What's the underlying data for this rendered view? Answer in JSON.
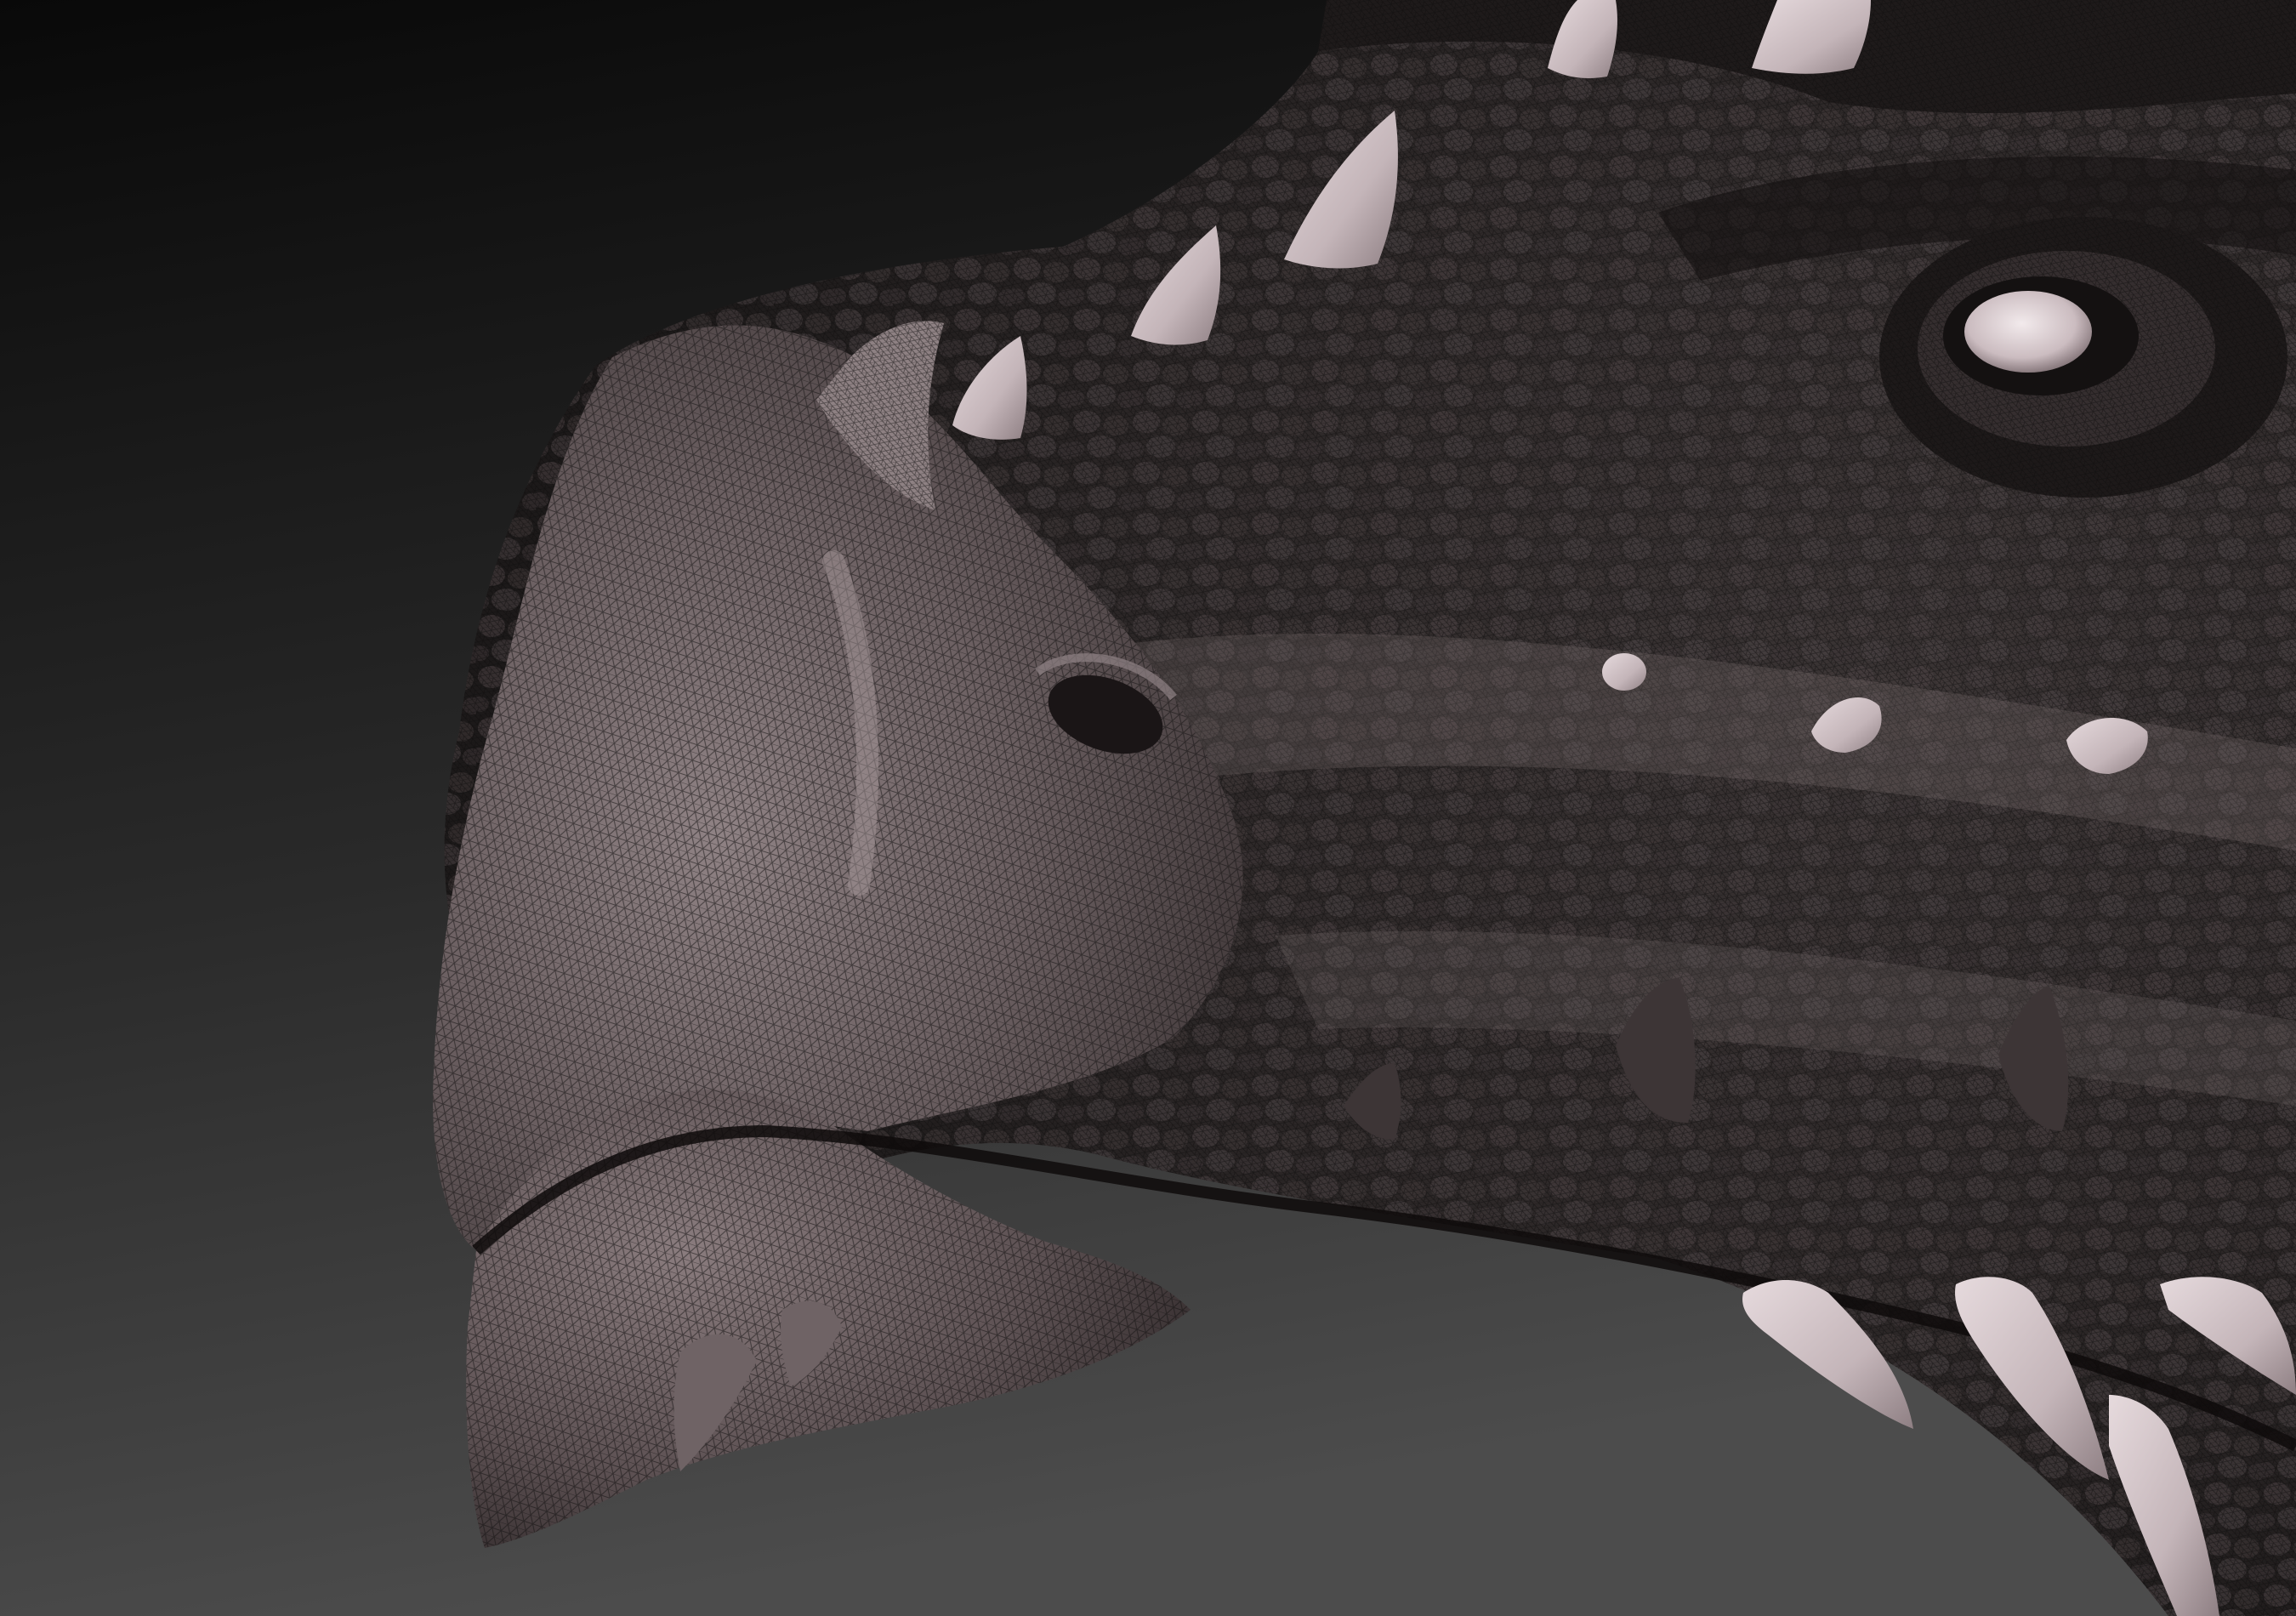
{
  "viewport": {
    "background_top": "#0b0b0b",
    "background_bottom": "#4a4a4a"
  },
  "model": {
    "subject": "creature-head-sculpt",
    "render_style": "wireframe-on-shaded",
    "skin_dark": "#2a2626",
    "skin_mid": "#5a5050",
    "skin_light": "#a89a9c",
    "spike_color": "#cdbfc3",
    "wire_color": "#141212"
  }
}
